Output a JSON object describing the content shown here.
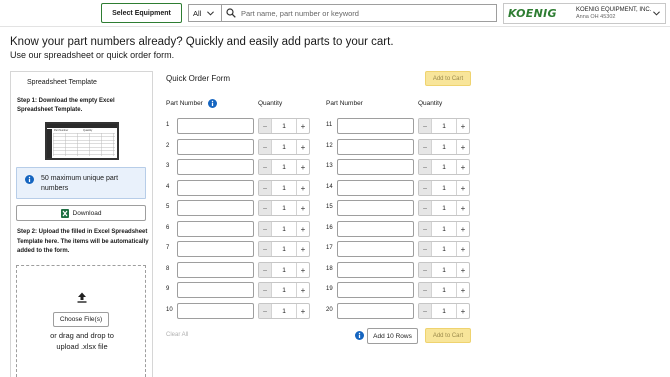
{
  "header": {
    "select_equipment": "Select Equipment",
    "category_select": "All",
    "search_placeholder": "Part name, part number or keyword",
    "logo_text": "KOENIG",
    "account_name": "KOENIG EQUIPMENT, INC.",
    "account_location": "Anna OH 45302"
  },
  "intro": {
    "headline": "Know your part numbers already? Quickly and easily add parts to your cart.",
    "subline": "Use our spreadsheet or quick order form."
  },
  "spreadsheet": {
    "title": "Spreadsheet Template",
    "step1": "Step 1: Download the empty Excel Spreadsheet Template.",
    "thumb_col1": "Part Number",
    "thumb_col2": "Quantity",
    "info_text": "50 maximum unique part numbers",
    "download_label": "Download",
    "step2": "Step 2: Upload the filled in Excel Spreadsheet Template here. The items will be automatically added to the form.",
    "choose_files": "Choose File(s)",
    "drag_text": "or drag and drop to upload .xlsx file"
  },
  "quick_order": {
    "title": "Quick Order Form",
    "add_to_cart": "Add to Cart",
    "col_part_number": "Part Number",
    "col_quantity": "Quantity",
    "clear_all": "Clear All",
    "add_rows": "Add 10 Rows",
    "minus_symbol": "−",
    "plus_symbol": "+",
    "rows": [
      {
        "num": "1",
        "part_number": "",
        "qty": "1"
      },
      {
        "num": "2",
        "part_number": "",
        "qty": "1"
      },
      {
        "num": "3",
        "part_number": "",
        "qty": "1"
      },
      {
        "num": "4",
        "part_number": "",
        "qty": "1"
      },
      {
        "num": "5",
        "part_number": "",
        "qty": "1"
      },
      {
        "num": "6",
        "part_number": "",
        "qty": "1"
      },
      {
        "num": "7",
        "part_number": "",
        "qty": "1"
      },
      {
        "num": "8",
        "part_number": "",
        "qty": "1"
      },
      {
        "num": "9",
        "part_number": "",
        "qty": "1"
      },
      {
        "num": "10",
        "part_number": "",
        "qty": "1"
      },
      {
        "num": "11",
        "part_number": "",
        "qty": "1"
      },
      {
        "num": "12",
        "part_number": "",
        "qty": "1"
      },
      {
        "num": "13",
        "part_number": "",
        "qty": "1"
      },
      {
        "num": "14",
        "part_number": "",
        "qty": "1"
      },
      {
        "num": "15",
        "part_number": "",
        "qty": "1"
      },
      {
        "num": "16",
        "part_number": "",
        "qty": "1"
      },
      {
        "num": "17",
        "part_number": "",
        "qty": "1"
      },
      {
        "num": "18",
        "part_number": "",
        "qty": "1"
      },
      {
        "num": "19",
        "part_number": "",
        "qty": "1"
      },
      {
        "num": "20",
        "part_number": "",
        "qty": "1"
      }
    ]
  },
  "colors": {
    "brand_green": "#2e7d32",
    "add_to_cart_bg": "#f8e59a",
    "info_blue": "#1565c0",
    "info_bg": "#e9f1fb"
  },
  "icons": {
    "search": "search-icon",
    "chevron": "chevron-down-icon",
    "info": "info-icon",
    "excel": "excel-icon",
    "upload": "upload-icon"
  }
}
